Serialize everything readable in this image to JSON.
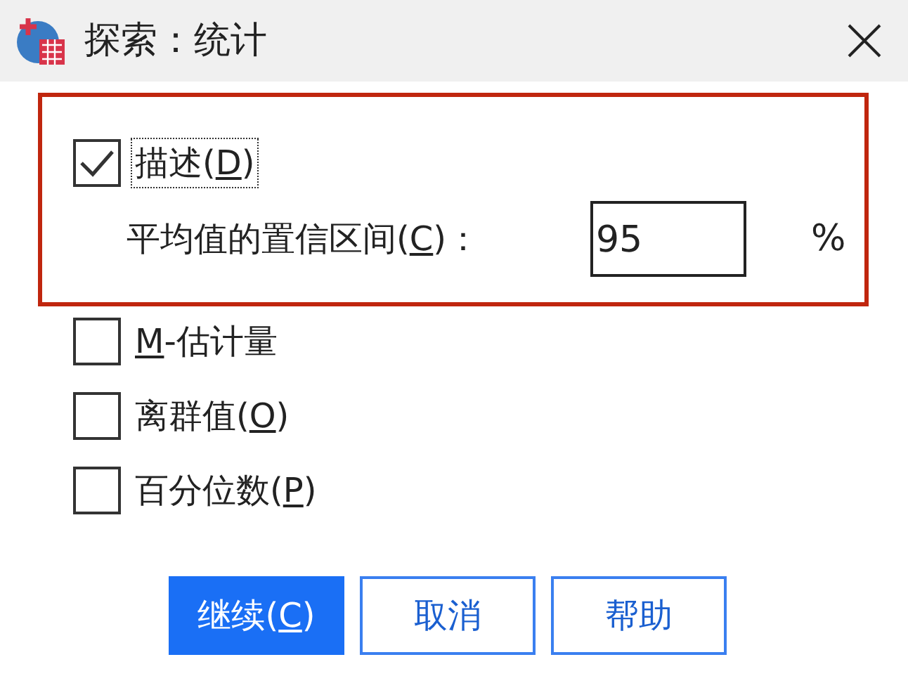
{
  "window": {
    "title": "探索：统计"
  },
  "highlighted_group": {
    "checkbox": {
      "label": "描述(",
      "mnemonic": "D",
      "suffix": ")",
      "checked": true,
      "focused": true
    },
    "confidence_interval": {
      "label": "平均值的置信区间(",
      "mnemonic": "C",
      "suffix": ")：",
      "value": "95",
      "unit": "%"
    }
  },
  "checkboxes": [
    {
      "mnemonic": "M",
      "suffix": "-估计量",
      "checked": false,
      "focused": false
    },
    {
      "label": "离群值(",
      "mnemonic": "O",
      "suffix": ")",
      "checked": false,
      "focused": false
    },
    {
      "label": "百分位数(",
      "mnemonic": "P",
      "suffix": ")",
      "checked": false,
      "focused": false
    }
  ],
  "buttons": [
    {
      "label": "继续(",
      "mnemonic": "C",
      "suffix": ")",
      "default": true
    },
    {
      "label": "取消",
      "default": false
    },
    {
      "label": "帮助",
      "default": false
    }
  ]
}
